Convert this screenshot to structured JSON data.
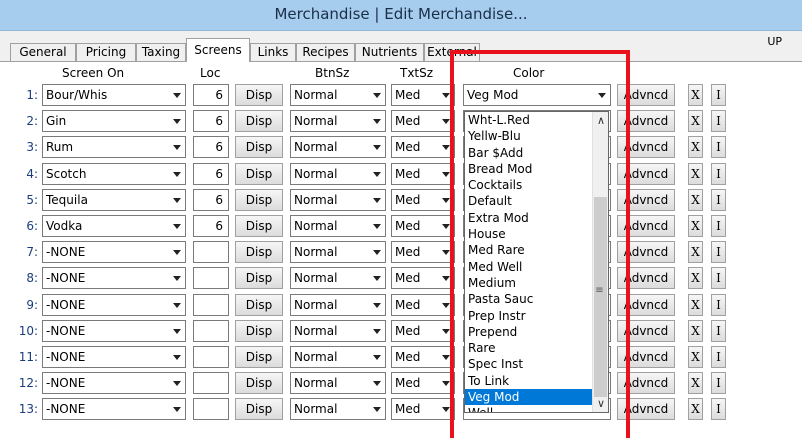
{
  "window": {
    "title": "Merchandise | Edit Merchandise..."
  },
  "up_label": "UP",
  "tabs": [
    "General",
    "Pricing",
    "Taxing",
    "Screens",
    "Links",
    "Recipes",
    "Nutrients",
    "External"
  ],
  "active_tab": "Screens",
  "headers": {
    "screen_on": "Screen On",
    "loc": "Loc",
    "btnsz": "BtnSz",
    "txtsz": "TxtSz",
    "color": "Color"
  },
  "buttons": {
    "disp": "Disp",
    "advanced": "Advncd",
    "x": "X",
    "i": "I"
  },
  "rows": [
    {
      "num": "1:",
      "screen": "Bour/Whis",
      "loc": "6",
      "btnsz": "Normal",
      "txtsz": "Med",
      "color": "Veg Mod"
    },
    {
      "num": "2:",
      "screen": "Gin",
      "loc": "6",
      "btnsz": "Normal",
      "txtsz": "Med",
      "color": ""
    },
    {
      "num": "3:",
      "screen": "Rum",
      "loc": "6",
      "btnsz": "Normal",
      "txtsz": "Med",
      "color": ""
    },
    {
      "num": "4:",
      "screen": "Scotch",
      "loc": "6",
      "btnsz": "Normal",
      "txtsz": "Med",
      "color": ""
    },
    {
      "num": "5:",
      "screen": "Tequila",
      "loc": "6",
      "btnsz": "Normal",
      "txtsz": "Med",
      "color": ""
    },
    {
      "num": "6:",
      "screen": "Vodka",
      "loc": "6",
      "btnsz": "Normal",
      "txtsz": "Med",
      "color": ""
    },
    {
      "num": "7:",
      "screen": "-NONE",
      "loc": "",
      "btnsz": "Normal",
      "txtsz": "Med",
      "color": ""
    },
    {
      "num": "8:",
      "screen": "-NONE",
      "loc": "",
      "btnsz": "Normal",
      "txtsz": "Med",
      "color": ""
    },
    {
      "num": "9:",
      "screen": "-NONE",
      "loc": "",
      "btnsz": "Normal",
      "txtsz": "Med",
      "color": ""
    },
    {
      "num": "10:",
      "screen": "-NONE",
      "loc": "",
      "btnsz": "Normal",
      "txtsz": "Med",
      "color": ""
    },
    {
      "num": "11:",
      "screen": "-NONE",
      "loc": "",
      "btnsz": "Normal",
      "txtsz": "Med",
      "color": ""
    },
    {
      "num": "12:",
      "screen": "-NONE",
      "loc": "",
      "btnsz": "Normal",
      "txtsz": "Med",
      "color": ""
    },
    {
      "num": "13:",
      "screen": "-NONE",
      "loc": "",
      "btnsz": "Normal",
      "txtsz": "Med",
      "color": ""
    }
  ],
  "color_dropdown": {
    "options": [
      "Wht-L.Red",
      "Yellw-Blu",
      "Bar $Add",
      "Bread Mod",
      "Cocktails",
      "Default",
      "Extra Mod",
      "House",
      "Med Rare",
      "Med Well",
      "Medium",
      "Pasta Sauc",
      "Prep Instr",
      "Prepend",
      "Rare",
      "Spec Inst",
      "To Link",
      "Veg Mod",
      "Well"
    ],
    "selected": "Veg Mod"
  },
  "colors": {
    "titlebar": "#a6ccee",
    "highlight": "#0078d7",
    "annotation": "#e8111c"
  }
}
